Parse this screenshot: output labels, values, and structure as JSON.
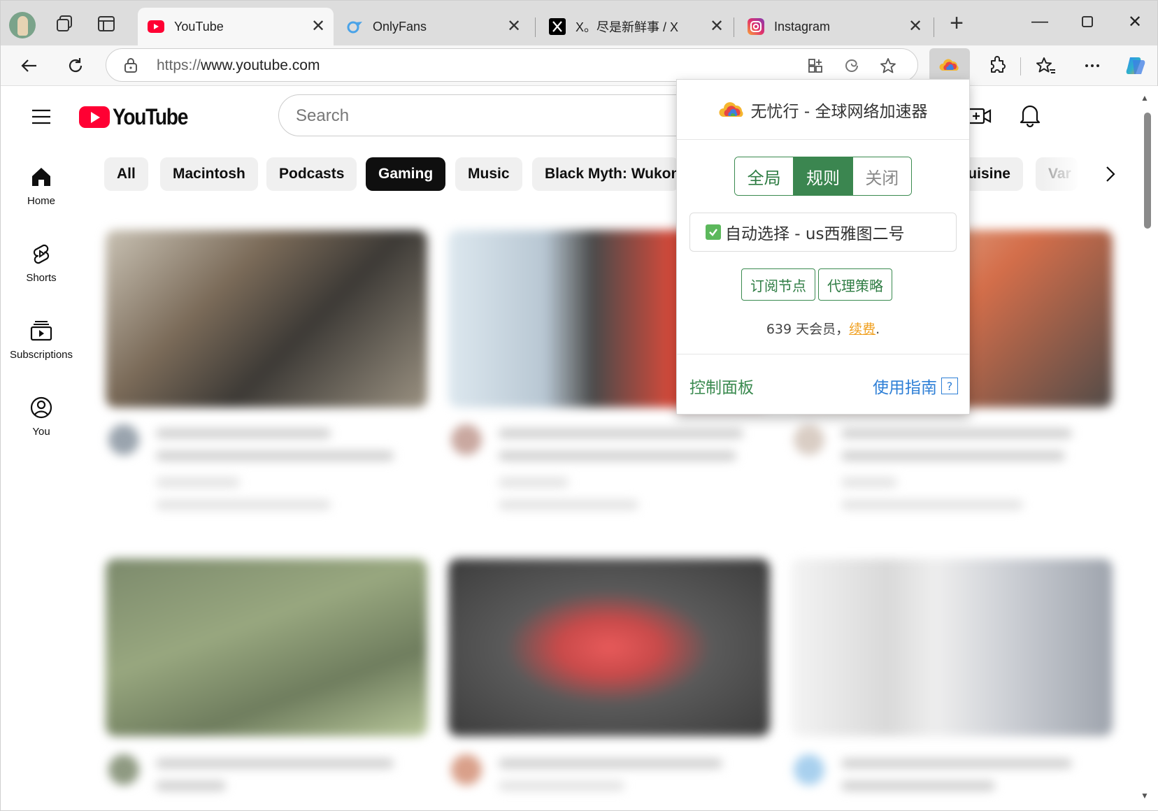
{
  "browser": {
    "tabs": [
      {
        "title": "YouTube",
        "active": true
      },
      {
        "title": "OnlyFans",
        "active": false
      },
      {
        "title": "X。尽是新鲜事 / X",
        "active": false
      },
      {
        "title": "Instagram",
        "active": false
      }
    ],
    "url_scheme": "https://",
    "url_host": "www.youtube.com"
  },
  "youtube": {
    "logo_text": "YouTube",
    "search_placeholder": "Search",
    "guide": [
      {
        "label": "Home",
        "icon": "home-icon"
      },
      {
        "label": "Shorts",
        "icon": "shorts-icon"
      },
      {
        "label": "Subscriptions",
        "icon": "subscriptions-icon"
      },
      {
        "label": "You",
        "icon": "you-icon"
      }
    ],
    "chips": [
      "All",
      "Macintosh",
      "Podcasts",
      "Gaming",
      "Music",
      "Black Myth: Wukong",
      "Cuisine",
      "Var"
    ],
    "active_chip": "Gaming"
  },
  "popup": {
    "title": "无忧行 - 全球网络加速器",
    "modes": [
      "全局",
      "规则",
      "关闭"
    ],
    "active_mode": "规则",
    "auto_select_label": "自动选择 - us西雅图二号",
    "subscribe_button": "订阅节点",
    "proxy_policy_button": "代理策略",
    "member_text": "639 天会员，",
    "renew_link": "续费",
    "member_suffix": ".",
    "control_panel_link": "控制面板",
    "guide_link": "使用指南",
    "guide_icon": "?"
  },
  "colors": {
    "youtube_red": "#ff0033",
    "popup_green": "#3b8650",
    "popup_blue": "#2e7fd6",
    "renew_orange": "#f0a020"
  }
}
